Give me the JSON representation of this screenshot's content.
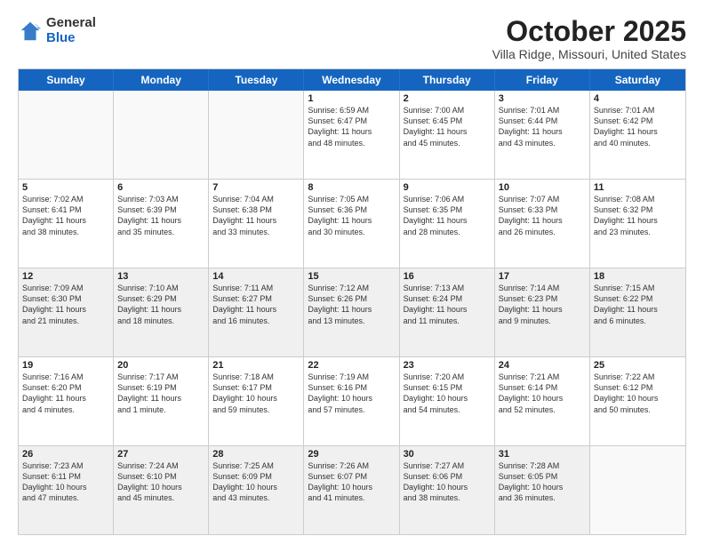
{
  "logo": {
    "general": "General",
    "blue": "Blue"
  },
  "header": {
    "title": "October 2025",
    "subtitle": "Villa Ridge, Missouri, United States"
  },
  "weekdays": [
    "Sunday",
    "Monday",
    "Tuesday",
    "Wednesday",
    "Thursday",
    "Friday",
    "Saturday"
  ],
  "weeks": [
    [
      {
        "day": "",
        "text": "",
        "empty": true
      },
      {
        "day": "",
        "text": "",
        "empty": true
      },
      {
        "day": "",
        "text": "",
        "empty": true
      },
      {
        "day": "1",
        "text": "Sunrise: 6:59 AM\nSunset: 6:47 PM\nDaylight: 11 hours\nand 48 minutes."
      },
      {
        "day": "2",
        "text": "Sunrise: 7:00 AM\nSunset: 6:45 PM\nDaylight: 11 hours\nand 45 minutes."
      },
      {
        "day": "3",
        "text": "Sunrise: 7:01 AM\nSunset: 6:44 PM\nDaylight: 11 hours\nand 43 minutes."
      },
      {
        "day": "4",
        "text": "Sunrise: 7:01 AM\nSunset: 6:42 PM\nDaylight: 11 hours\nand 40 minutes."
      }
    ],
    [
      {
        "day": "5",
        "text": "Sunrise: 7:02 AM\nSunset: 6:41 PM\nDaylight: 11 hours\nand 38 minutes."
      },
      {
        "day": "6",
        "text": "Sunrise: 7:03 AM\nSunset: 6:39 PM\nDaylight: 11 hours\nand 35 minutes."
      },
      {
        "day": "7",
        "text": "Sunrise: 7:04 AM\nSunset: 6:38 PM\nDaylight: 11 hours\nand 33 minutes."
      },
      {
        "day": "8",
        "text": "Sunrise: 7:05 AM\nSunset: 6:36 PM\nDaylight: 11 hours\nand 30 minutes."
      },
      {
        "day": "9",
        "text": "Sunrise: 7:06 AM\nSunset: 6:35 PM\nDaylight: 11 hours\nand 28 minutes."
      },
      {
        "day": "10",
        "text": "Sunrise: 7:07 AM\nSunset: 6:33 PM\nDaylight: 11 hours\nand 26 minutes."
      },
      {
        "day": "11",
        "text": "Sunrise: 7:08 AM\nSunset: 6:32 PM\nDaylight: 11 hours\nand 23 minutes."
      }
    ],
    [
      {
        "day": "12",
        "text": "Sunrise: 7:09 AM\nSunset: 6:30 PM\nDaylight: 11 hours\nand 21 minutes.",
        "shaded": true
      },
      {
        "day": "13",
        "text": "Sunrise: 7:10 AM\nSunset: 6:29 PM\nDaylight: 11 hours\nand 18 minutes.",
        "shaded": true
      },
      {
        "day": "14",
        "text": "Sunrise: 7:11 AM\nSunset: 6:27 PM\nDaylight: 11 hours\nand 16 minutes.",
        "shaded": true
      },
      {
        "day": "15",
        "text": "Sunrise: 7:12 AM\nSunset: 6:26 PM\nDaylight: 11 hours\nand 13 minutes.",
        "shaded": true
      },
      {
        "day": "16",
        "text": "Sunrise: 7:13 AM\nSunset: 6:24 PM\nDaylight: 11 hours\nand 11 minutes.",
        "shaded": true
      },
      {
        "day": "17",
        "text": "Sunrise: 7:14 AM\nSunset: 6:23 PM\nDaylight: 11 hours\nand 9 minutes.",
        "shaded": true
      },
      {
        "day": "18",
        "text": "Sunrise: 7:15 AM\nSunset: 6:22 PM\nDaylight: 11 hours\nand 6 minutes.",
        "shaded": true
      }
    ],
    [
      {
        "day": "19",
        "text": "Sunrise: 7:16 AM\nSunset: 6:20 PM\nDaylight: 11 hours\nand 4 minutes."
      },
      {
        "day": "20",
        "text": "Sunrise: 7:17 AM\nSunset: 6:19 PM\nDaylight: 11 hours\nand 1 minute."
      },
      {
        "day": "21",
        "text": "Sunrise: 7:18 AM\nSunset: 6:17 PM\nDaylight: 10 hours\nand 59 minutes."
      },
      {
        "day": "22",
        "text": "Sunrise: 7:19 AM\nSunset: 6:16 PM\nDaylight: 10 hours\nand 57 minutes."
      },
      {
        "day": "23",
        "text": "Sunrise: 7:20 AM\nSunset: 6:15 PM\nDaylight: 10 hours\nand 54 minutes."
      },
      {
        "day": "24",
        "text": "Sunrise: 7:21 AM\nSunset: 6:14 PM\nDaylight: 10 hours\nand 52 minutes."
      },
      {
        "day": "25",
        "text": "Sunrise: 7:22 AM\nSunset: 6:12 PM\nDaylight: 10 hours\nand 50 minutes."
      }
    ],
    [
      {
        "day": "26",
        "text": "Sunrise: 7:23 AM\nSunset: 6:11 PM\nDaylight: 10 hours\nand 47 minutes.",
        "shaded": true
      },
      {
        "day": "27",
        "text": "Sunrise: 7:24 AM\nSunset: 6:10 PM\nDaylight: 10 hours\nand 45 minutes.",
        "shaded": true
      },
      {
        "day": "28",
        "text": "Sunrise: 7:25 AM\nSunset: 6:09 PM\nDaylight: 10 hours\nand 43 minutes.",
        "shaded": true
      },
      {
        "day": "29",
        "text": "Sunrise: 7:26 AM\nSunset: 6:07 PM\nDaylight: 10 hours\nand 41 minutes.",
        "shaded": true
      },
      {
        "day": "30",
        "text": "Sunrise: 7:27 AM\nSunset: 6:06 PM\nDaylight: 10 hours\nand 38 minutes.",
        "shaded": true
      },
      {
        "day": "31",
        "text": "Sunrise: 7:28 AM\nSunset: 6:05 PM\nDaylight: 10 hours\nand 36 minutes.",
        "shaded": true
      },
      {
        "day": "",
        "text": "",
        "empty": true,
        "shaded": true
      }
    ]
  ]
}
